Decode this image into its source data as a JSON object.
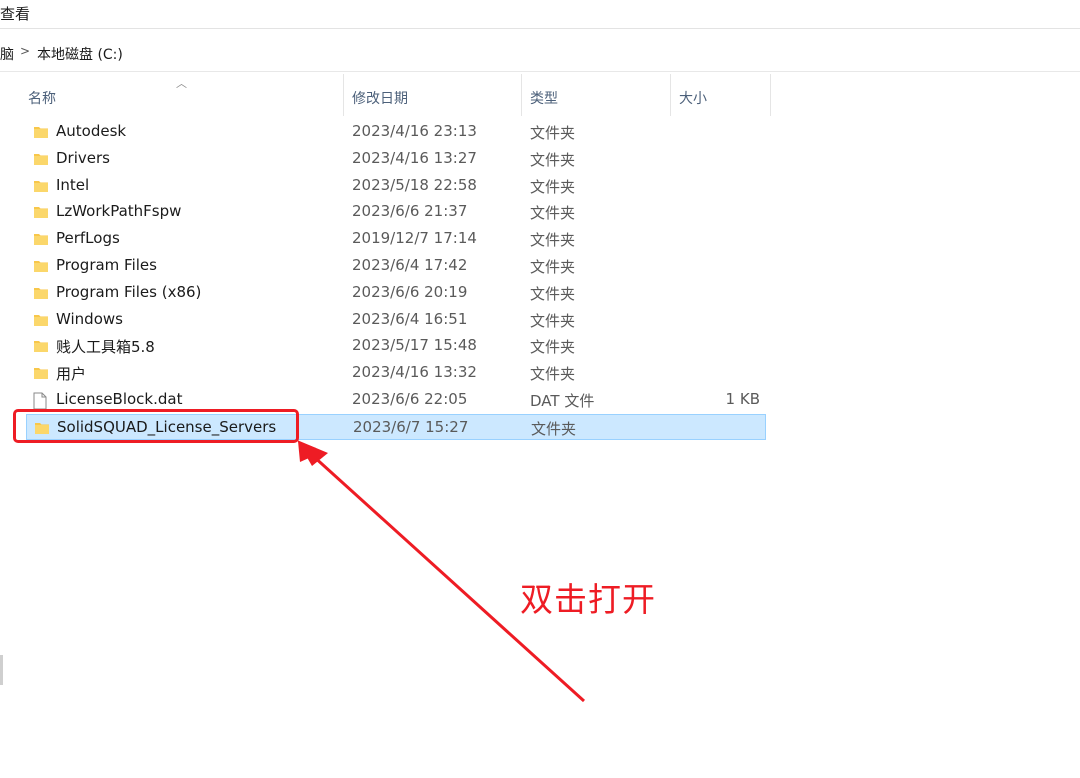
{
  "ribbon": {
    "view_tab": "查看"
  },
  "address": {
    "prev_crumb": "脑",
    "separator": ">",
    "current_crumb": "本地磁盘 (C:)"
  },
  "columns": {
    "name": "名称",
    "date": "修改日期",
    "type": "类型",
    "size": "大小"
  },
  "files": [
    {
      "name": "Autodesk",
      "date": "2023/4/16 23:13",
      "type": "文件夹",
      "size": "",
      "icon": "folder-icon"
    },
    {
      "name": "Drivers",
      "date": "2023/4/16 13:27",
      "type": "文件夹",
      "size": "",
      "icon": "folder-icon"
    },
    {
      "name": "Intel",
      "date": "2023/5/18 22:58",
      "type": "文件夹",
      "size": "",
      "icon": "folder-icon"
    },
    {
      "name": "LzWorkPathFspw",
      "date": "2023/6/6 21:37",
      "type": "文件夹",
      "size": "",
      "icon": "folder-icon"
    },
    {
      "name": "PerfLogs",
      "date": "2019/12/7 17:14",
      "type": "文件夹",
      "size": "",
      "icon": "folder-icon"
    },
    {
      "name": "Program Files",
      "date": "2023/6/4 17:42",
      "type": "文件夹",
      "size": "",
      "icon": "folder-icon"
    },
    {
      "name": "Program Files (x86)",
      "date": "2023/6/6 20:19",
      "type": "文件夹",
      "size": "",
      "icon": "folder-icon"
    },
    {
      "name": "Windows",
      "date": "2023/6/4 16:51",
      "type": "文件夹",
      "size": "",
      "icon": "folder-icon"
    },
    {
      "name": "贱人工具箱5.8",
      "date": "2023/5/17 15:48",
      "type": "文件夹",
      "size": "",
      "icon": "folder-icon"
    },
    {
      "name": "用户",
      "date": "2023/4/16 13:32",
      "type": "文件夹",
      "size": "",
      "icon": "folder-icon"
    },
    {
      "name": "LicenseBlock.dat",
      "date": "2023/6/6 22:05",
      "type": "DAT 文件",
      "size": "1 KB",
      "icon": "file-icon"
    },
    {
      "name": "SolidSQUAD_License_Servers",
      "date": "2023/6/7 15:27",
      "type": "文件夹",
      "size": "",
      "icon": "folder-icon",
      "selected": true
    }
  ],
  "annotation": {
    "text": "双击打开",
    "color": "#ee1c24"
  },
  "colors": {
    "selection_bg": "#cce8ff",
    "folder": "#f8c74a",
    "annotation_red": "#ee1c24"
  }
}
